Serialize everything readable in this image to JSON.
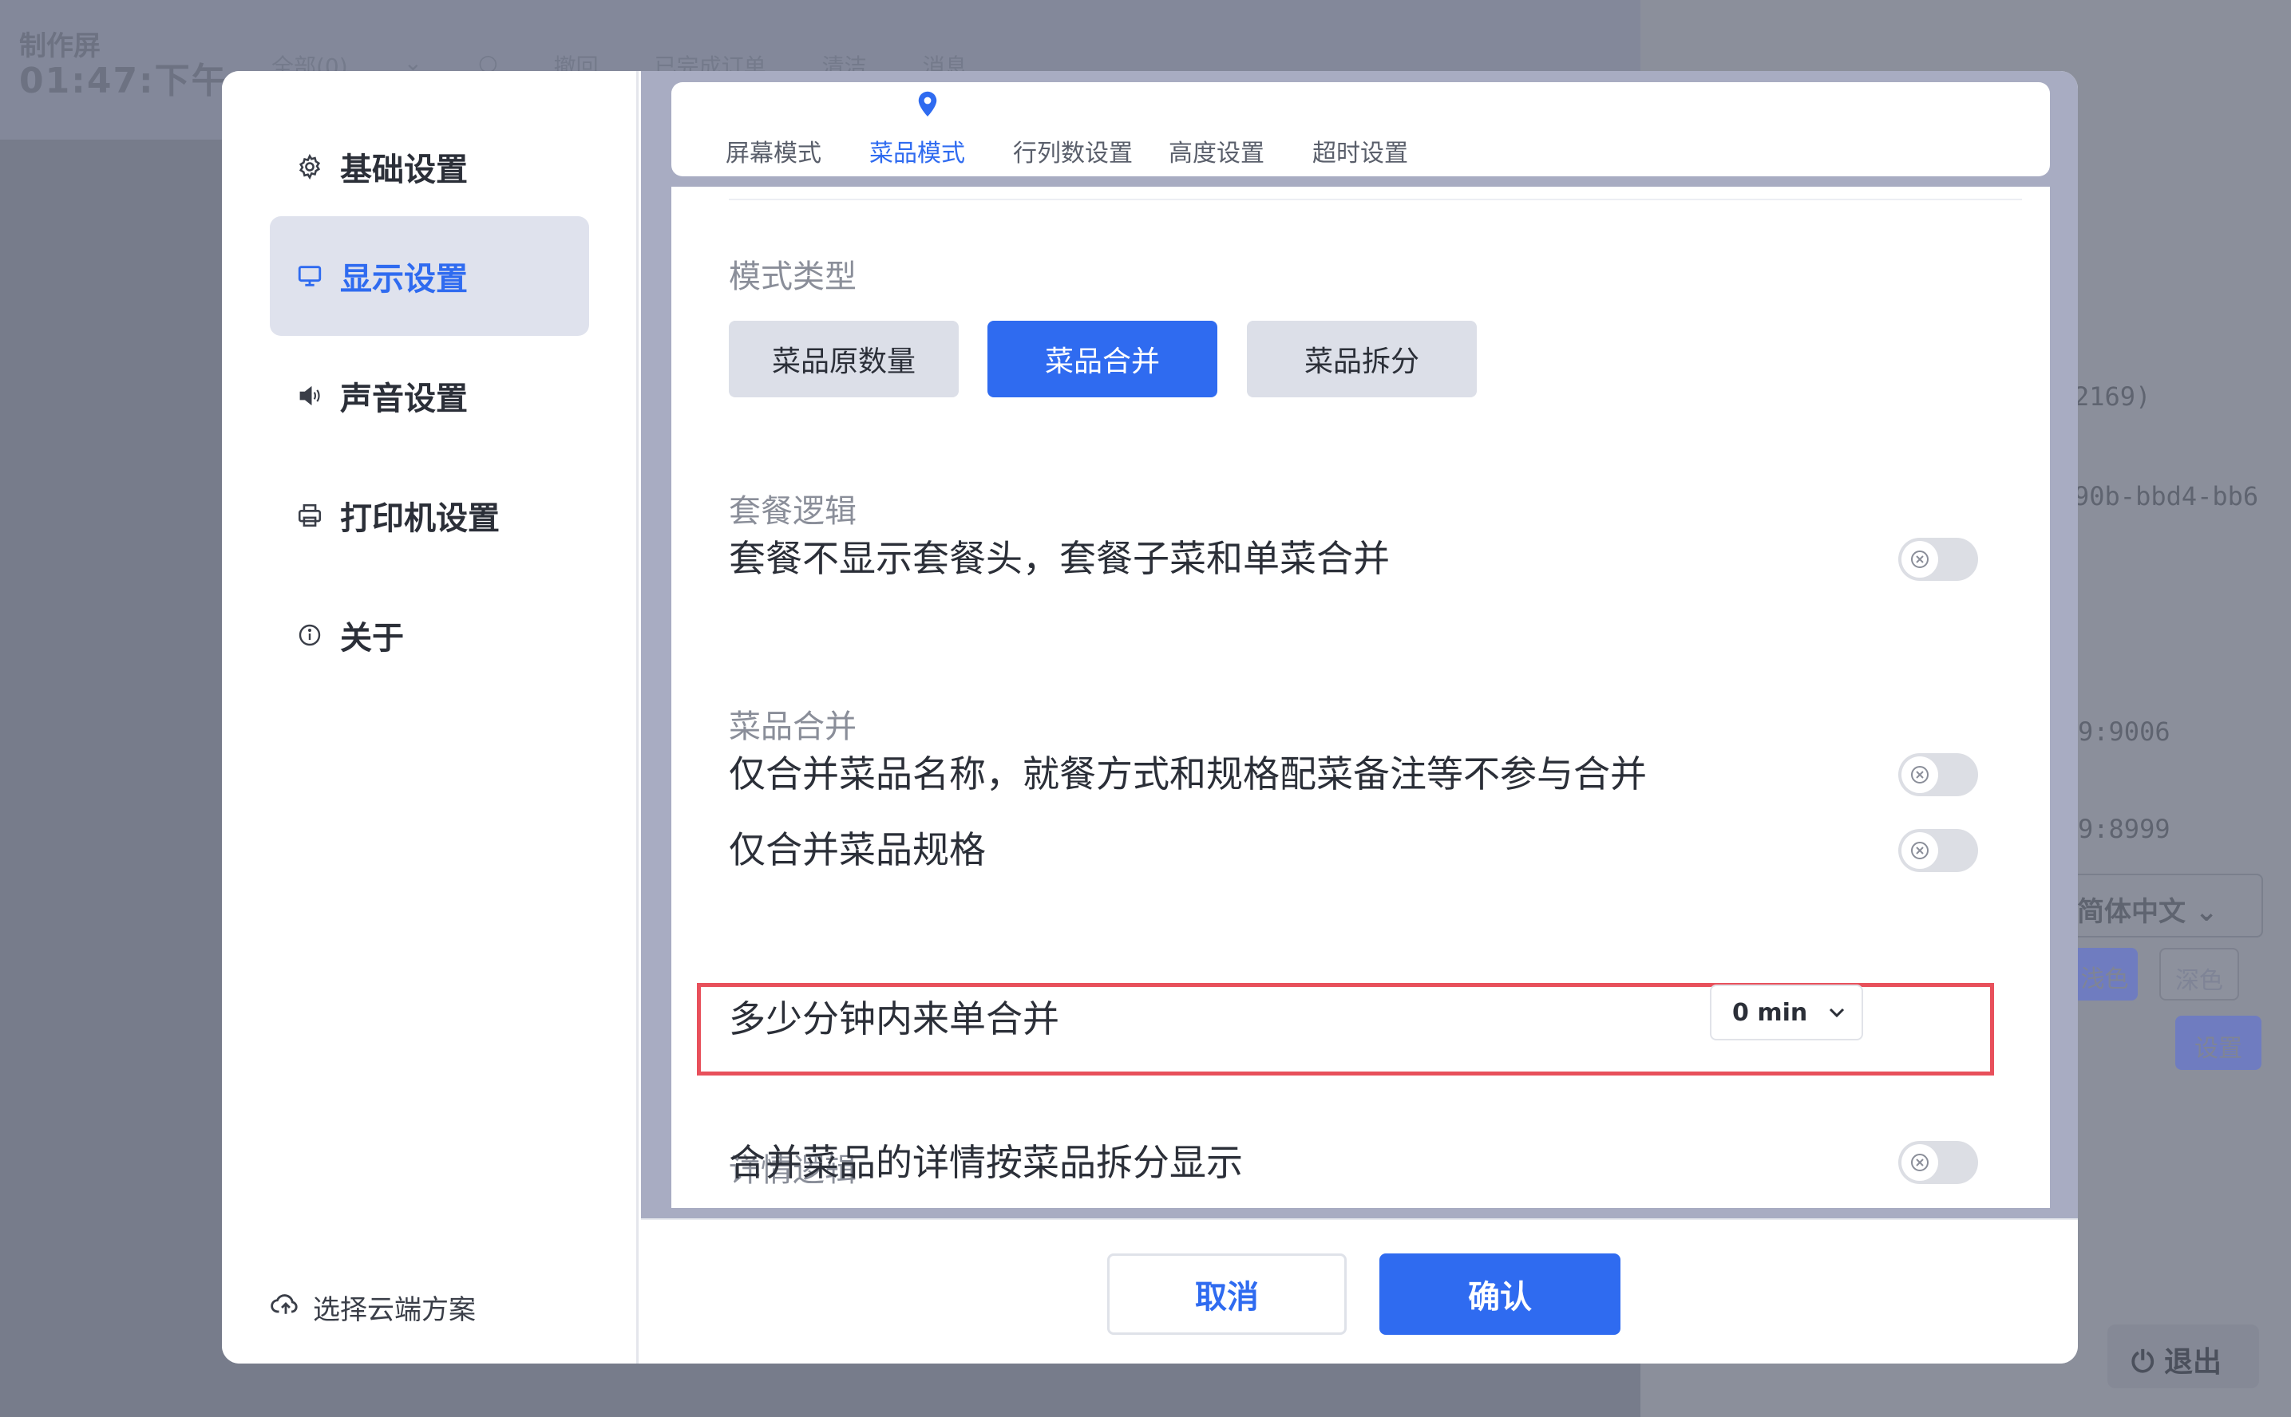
{
  "background": {
    "brand_title": "制作屏",
    "brand_time": "01:47:下午",
    "top_tabs": [
      "全部(0)",
      "⌄",
      "○",
      "撤回",
      "已完成订单",
      "清洁",
      "消息"
    ],
    "right_texts": [
      "2169)",
      "90b-bbd4-bb6",
      "9:9006",
      "9:8999"
    ],
    "language": "简体中文",
    "theme_light": "浅色",
    "theme_dark": "深色",
    "settings_button": "设置",
    "logout": "退出"
  },
  "sidebar": {
    "items": [
      {
        "label": "基础设置",
        "icon": "gear-icon"
      },
      {
        "label": "显示设置",
        "icon": "monitor-icon"
      },
      {
        "label": "声音设置",
        "icon": "speaker-icon"
      },
      {
        "label": "打印机设置",
        "icon": "printer-icon"
      },
      {
        "label": "关于",
        "icon": "info-icon"
      }
    ],
    "active_index": 1,
    "cloud_label": "选择云端方案"
  },
  "tabs": {
    "items": [
      "屏幕模式",
      "菜品模式",
      "行列数设置",
      "高度设置",
      "超时设置"
    ],
    "active_index": 1
  },
  "mode_type": {
    "title": "模式类型",
    "options": [
      "菜品原数量",
      "菜品合并",
      "菜品拆分"
    ],
    "selected_index": 1
  },
  "set_meal": {
    "title": "套餐逻辑",
    "rows": [
      {
        "label": "套餐不显示套餐头，套餐子菜和单菜合并",
        "enabled": false
      }
    ]
  },
  "dish_merge": {
    "title": "菜品合并",
    "rows": [
      {
        "label": "仅合并菜品名称，就餐方式和规格配菜备注等不参与合并",
        "enabled": false
      },
      {
        "label": "仅合并菜品规格",
        "enabled": false
      }
    ],
    "minutes_label": "多少分钟内来单合并",
    "minutes_value": "0 min"
  },
  "detail": {
    "title": "详情逻辑",
    "rows": [
      {
        "label": "合并菜品的详情按菜品拆分显示",
        "enabled": false
      }
    ]
  },
  "footer": {
    "cancel": "取消",
    "confirm": "确认"
  },
  "colors": {
    "accent": "#2f6bf0",
    "highlight_border": "#e8505b"
  }
}
